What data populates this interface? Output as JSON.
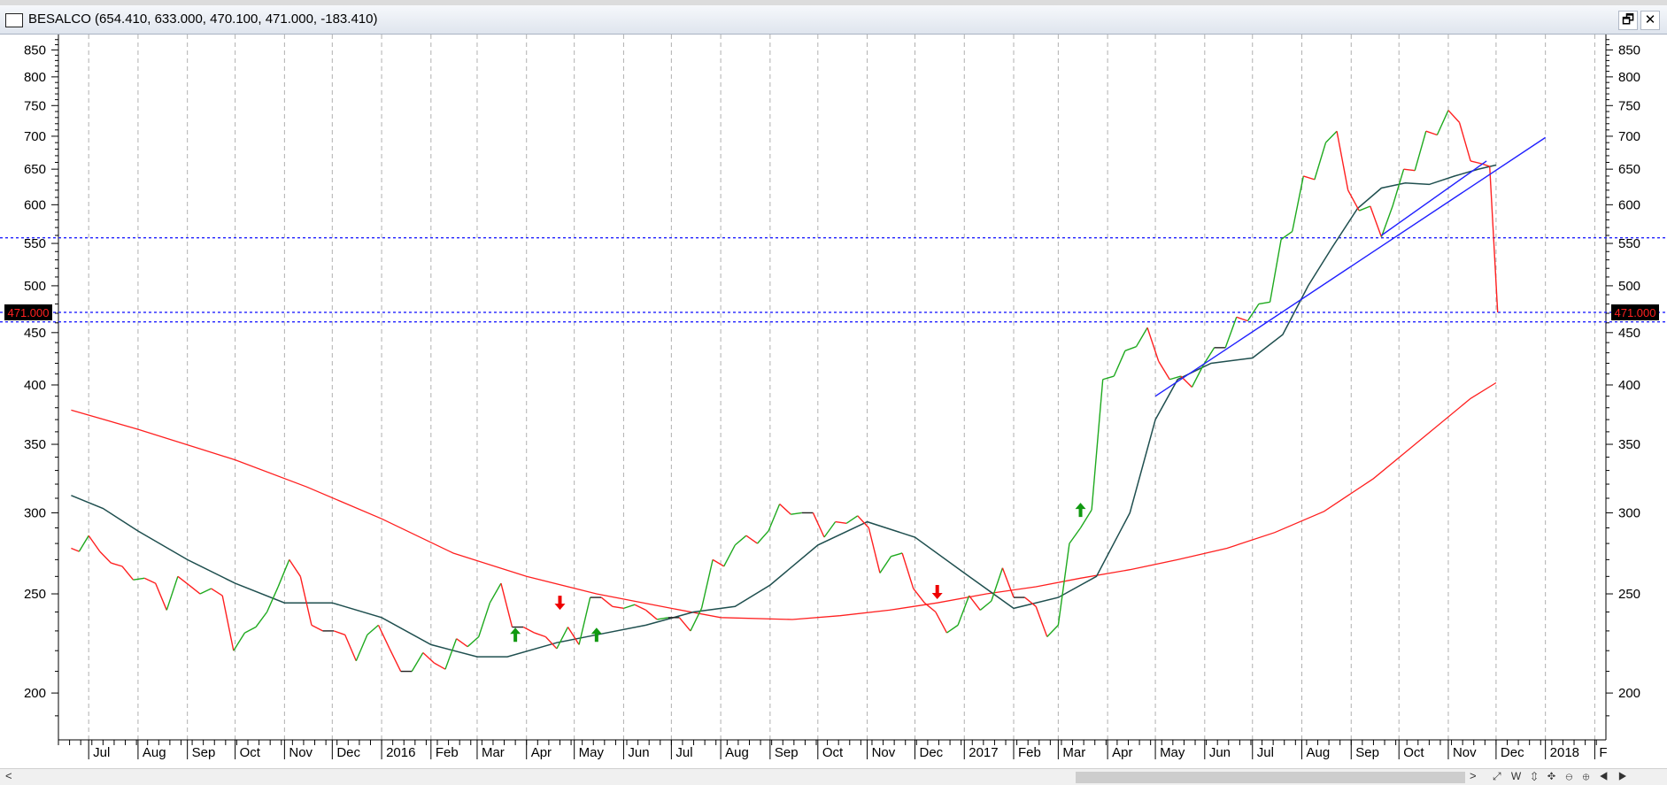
{
  "window": {
    "title": "BESALCO (654.410, 633.000, 470.100, 471.000, -183.410)",
    "restore_glyph": "🗗",
    "close_glyph": "✕"
  },
  "scrollbar": {
    "left_arrow": "<",
    "right_arrow": ">",
    "tool_glyphs": "⤢ W ⇕ ✥ ⊖ ⊕ ◀ ▶"
  },
  "chart_data": {
    "type": "line",
    "y_scale": "log",
    "ylim": [
      180,
      880
    ],
    "y_ticks": [
      200,
      250,
      300,
      350,
      400,
      450,
      500,
      550,
      600,
      650,
      700,
      750,
      800,
      850
    ],
    "last_price_label": "471.000",
    "last_price": 471,
    "x_labels": [
      {
        "label": "Jul",
        "date": "2015-07"
      },
      {
        "label": "Aug",
        "date": "2015-08"
      },
      {
        "label": "Sep",
        "date": "2015-09"
      },
      {
        "label": "Oct",
        "date": "2015-10"
      },
      {
        "label": "Nov",
        "date": "2015-11"
      },
      {
        "label": "Dec",
        "date": "2015-12"
      },
      {
        "label": "2016",
        "date": "2016-01"
      },
      {
        "label": "Feb",
        "date": "2016-02"
      },
      {
        "label": "Mar",
        "date": "2016-03"
      },
      {
        "label": "Apr",
        "date": "2016-04"
      },
      {
        "label": "May",
        "date": "2016-05"
      },
      {
        "label": "Jun",
        "date": "2016-06"
      },
      {
        "label": "Jul",
        "date": "2016-07"
      },
      {
        "label": "Aug",
        "date": "2016-08"
      },
      {
        "label": "Sep",
        "date": "2016-09"
      },
      {
        "label": "Oct",
        "date": "2016-10"
      },
      {
        "label": "Nov",
        "date": "2016-11"
      },
      {
        "label": "Dec",
        "date": "2016-12"
      },
      {
        "label": "2017",
        "date": "2017-01"
      },
      {
        "label": "Feb",
        "date": "2017-02"
      },
      {
        "label": "Mar",
        "date": "2017-03"
      },
      {
        "label": "Apr",
        "date": "2017-04"
      },
      {
        "label": "May",
        "date": "2017-05"
      },
      {
        "label": "Jun",
        "date": "2017-06"
      },
      {
        "label": "Jul",
        "date": "2017-07"
      },
      {
        "label": "Aug",
        "date": "2017-08"
      },
      {
        "label": "Sep",
        "date": "2017-09"
      },
      {
        "label": "Oct",
        "date": "2017-10"
      },
      {
        "label": "Nov",
        "date": "2017-11"
      },
      {
        "label": "Dec",
        "date": "2017-12"
      },
      {
        "label": "2018",
        "date": "2018-01"
      },
      {
        "label": "F",
        "date": "2018-02"
      }
    ],
    "horizontal_lines": [
      {
        "value": 557,
        "color": "#2020ff",
        "style": "dotted"
      },
      {
        "value": 471,
        "color": "#2020ff",
        "style": "dotted"
      },
      {
        "value": 461,
        "color": "#2020ff",
        "style": "dotted"
      }
    ],
    "trendlines": [
      {
        "color": "#2020ff",
        "points": [
          [
            "2017-05-01",
            390
          ],
          [
            "2018-01-01",
            698
          ]
        ]
      },
      {
        "color": "#2020ff",
        "points": [
          [
            "2017-09-20",
            560
          ],
          [
            "2017-11-25",
            662
          ]
        ]
      }
    ],
    "signals": [
      {
        "date": "2016-03-25",
        "value": 228,
        "kind": "buy"
      },
      {
        "date": "2016-04-22",
        "value": 245,
        "kind": "sell"
      },
      {
        "date": "2016-05-15",
        "value": 228,
        "kind": "buy"
      },
      {
        "date": "2016-12-15",
        "value": 251,
        "kind": "sell"
      },
      {
        "date": "2017-03-15",
        "value": 302,
        "kind": "buy"
      }
    ],
    "series": [
      {
        "kind": "price",
        "color_up": "#1faa1f",
        "color_down": "#ff2020",
        "color_neutral": "#222222",
        "points": [
          [
            "2015-06-20",
            277
          ],
          [
            "2015-06-25",
            275
          ],
          [
            "2015-07-01",
            285
          ],
          [
            "2015-07-08",
            275
          ],
          [
            "2015-07-15",
            268
          ],
          [
            "2015-07-22",
            266
          ],
          [
            "2015-07-29",
            258
          ],
          [
            "2015-08-05",
            259
          ],
          [
            "2015-08-12",
            256
          ],
          [
            "2015-08-19",
            241
          ],
          [
            "2015-08-26",
            260
          ],
          [
            "2015-09-02",
            255
          ],
          [
            "2015-09-09",
            250
          ],
          [
            "2015-09-16",
            253
          ],
          [
            "2015-09-23",
            249
          ],
          [
            "2015-09-30",
            220
          ],
          [
            "2015-10-07",
            229
          ],
          [
            "2015-10-14",
            232
          ],
          [
            "2015-10-21",
            240
          ],
          [
            "2015-10-28",
            254
          ],
          [
            "2015-11-04",
            270
          ],
          [
            "2015-11-11",
            260
          ],
          [
            "2015-11-18",
            233
          ],
          [
            "2015-11-25",
            230
          ],
          [
            "2015-12-02",
            230
          ],
          [
            "2015-12-09",
            228
          ],
          [
            "2015-12-16",
            215
          ],
          [
            "2015-12-23",
            228
          ],
          [
            "2015-12-30",
            233
          ],
          [
            "2016-01-06",
            221
          ],
          [
            "2016-01-13",
            210
          ],
          [
            "2016-01-20",
            210
          ],
          [
            "2016-01-27",
            219
          ],
          [
            "2016-02-03",
            214
          ],
          [
            "2016-02-10",
            211
          ],
          [
            "2016-02-17",
            226
          ],
          [
            "2016-02-24",
            222
          ],
          [
            "2016-03-02",
            227
          ],
          [
            "2016-03-09",
            245
          ],
          [
            "2016-03-16",
            256
          ],
          [
            "2016-03-23",
            232
          ],
          [
            "2016-03-30",
            232
          ],
          [
            "2016-04-06",
            229
          ],
          [
            "2016-04-13",
            227
          ],
          [
            "2016-04-20",
            221
          ],
          [
            "2016-04-27",
            232
          ],
          [
            "2016-05-04",
            223
          ],
          [
            "2016-05-11",
            248
          ],
          [
            "2016-05-18",
            248
          ],
          [
            "2016-05-25",
            243
          ],
          [
            "2016-06-01",
            242
          ],
          [
            "2016-06-08",
            244
          ],
          [
            "2016-06-15",
            241
          ],
          [
            "2016-06-22",
            236
          ],
          [
            "2016-06-29",
            237
          ],
          [
            "2016-07-06",
            237
          ],
          [
            "2016-07-13",
            230
          ],
          [
            "2016-07-20",
            242
          ],
          [
            "2016-07-27",
            270
          ],
          [
            "2016-08-03",
            266
          ],
          [
            "2016-08-10",
            279
          ],
          [
            "2016-08-17",
            285
          ],
          [
            "2016-08-24",
            280
          ],
          [
            "2016-08-31",
            288
          ],
          [
            "2016-09-07",
            306
          ],
          [
            "2016-09-14",
            299
          ],
          [
            "2016-09-21",
            300
          ],
          [
            "2016-09-28",
            300
          ],
          [
            "2016-10-05",
            284
          ],
          [
            "2016-10-12",
            294
          ],
          [
            "2016-10-19",
            293
          ],
          [
            "2016-10-26",
            298
          ],
          [
            "2016-11-02",
            290
          ],
          [
            "2016-11-09",
            262
          ],
          [
            "2016-11-16",
            272
          ],
          [
            "2016-11-23",
            274
          ],
          [
            "2016-11-30",
            253
          ],
          [
            "2016-12-07",
            245
          ],
          [
            "2016-12-14",
            240
          ],
          [
            "2016-12-21",
            229
          ],
          [
            "2016-12-28",
            233
          ],
          [
            "2017-01-04",
            249
          ],
          [
            "2017-01-11",
            241
          ],
          [
            "2017-01-18",
            246
          ],
          [
            "2017-01-25",
            265
          ],
          [
            "2017-02-01",
            248
          ],
          [
            "2017-02-08",
            248
          ],
          [
            "2017-02-15",
            243
          ],
          [
            "2017-02-22",
            227
          ],
          [
            "2017-03-01",
            233
          ],
          [
            "2017-03-08",
            280
          ],
          [
            "2017-03-15",
            290
          ],
          [
            "2017-03-22",
            302
          ],
          [
            "2017-03-29",
            405
          ],
          [
            "2017-04-05",
            408
          ],
          [
            "2017-04-12",
            432
          ],
          [
            "2017-04-19",
            436
          ],
          [
            "2017-04-26",
            455
          ],
          [
            "2017-05-03",
            422
          ],
          [
            "2017-05-10",
            405
          ],
          [
            "2017-05-17",
            408
          ],
          [
            "2017-05-24",
            398
          ],
          [
            "2017-05-31",
            418
          ],
          [
            "2017-06-07",
            435
          ],
          [
            "2017-06-14",
            435
          ],
          [
            "2017-06-21",
            466
          ],
          [
            "2017-06-28",
            462
          ],
          [
            "2017-07-05",
            480
          ],
          [
            "2017-07-12",
            482
          ],
          [
            "2017-07-19",
            555
          ],
          [
            "2017-07-26",
            565
          ],
          [
            "2017-08-02",
            640
          ],
          [
            "2017-08-09",
            635
          ],
          [
            "2017-08-16",
            690
          ],
          [
            "2017-08-23",
            708
          ],
          [
            "2017-08-30",
            620
          ],
          [
            "2017-09-06",
            592
          ],
          [
            "2017-09-13",
            598
          ],
          [
            "2017-09-20",
            558
          ],
          [
            "2017-09-27",
            598
          ],
          [
            "2017-10-04",
            650
          ],
          [
            "2017-10-11",
            648
          ],
          [
            "2017-10-18",
            708
          ],
          [
            "2017-10-25",
            702
          ],
          [
            "2017-11-01",
            742
          ],
          [
            "2017-11-08",
            722
          ],
          [
            "2017-11-15",
            662
          ],
          [
            "2017-11-22",
            658
          ],
          [
            "2017-11-27",
            654
          ],
          [
            "2017-12-02",
            471
          ]
        ]
      },
      {
        "kind": "sma-short",
        "color": "#1f4f4f",
        "points": [
          [
            "2015-06-20",
            312
          ],
          [
            "2015-07-10",
            303
          ],
          [
            "2015-08-01",
            288
          ],
          [
            "2015-09-01",
            270
          ],
          [
            "2015-10-01",
            256
          ],
          [
            "2015-11-01",
            245
          ],
          [
            "2015-12-01",
            245
          ],
          [
            "2016-01-01",
            237
          ],
          [
            "2016-02-01",
            223
          ],
          [
            "2016-03-01",
            217
          ],
          [
            "2016-03-20",
            217
          ],
          [
            "2016-04-20",
            224
          ],
          [
            "2016-05-15",
            228
          ],
          [
            "2016-06-15",
            233
          ],
          [
            "2016-07-15",
            240
          ],
          [
            "2016-08-10",
            243
          ],
          [
            "2016-09-01",
            255
          ],
          [
            "2016-10-01",
            279
          ],
          [
            "2016-11-01",
            294
          ],
          [
            "2016-12-01",
            284
          ],
          [
            "2017-01-01",
            262
          ],
          [
            "2017-02-01",
            242
          ],
          [
            "2017-03-01",
            248
          ],
          [
            "2017-03-25",
            260
          ],
          [
            "2017-04-15",
            300
          ],
          [
            "2017-05-01",
            370
          ],
          [
            "2017-05-15",
            405
          ],
          [
            "2017-06-05",
            420
          ],
          [
            "2017-07-01",
            425
          ],
          [
            "2017-07-20",
            448
          ],
          [
            "2017-08-05",
            500
          ],
          [
            "2017-08-20",
            545
          ],
          [
            "2017-09-05",
            595
          ],
          [
            "2017-09-20",
            623
          ],
          [
            "2017-10-05",
            630
          ],
          [
            "2017-10-20",
            628
          ],
          [
            "2017-11-05",
            640
          ],
          [
            "2017-11-20",
            650
          ],
          [
            "2017-12-01",
            656
          ]
        ]
      },
      {
        "kind": "sma-long",
        "color": "#ff2020",
        "points": [
          [
            "2015-06-20",
            378
          ],
          [
            "2015-08-01",
            362
          ],
          [
            "2015-10-01",
            338
          ],
          [
            "2015-11-15",
            318
          ],
          [
            "2016-01-01",
            296
          ],
          [
            "2016-02-15",
            274
          ],
          [
            "2016-04-01",
            260
          ],
          [
            "2016-05-15",
            250
          ],
          [
            "2016-07-01",
            242
          ],
          [
            "2016-08-01",
            237
          ],
          [
            "2016-09-15",
            236
          ],
          [
            "2016-10-15",
            238
          ],
          [
            "2016-11-15",
            241
          ],
          [
            "2016-12-15",
            245
          ],
          [
            "2017-01-15",
            250
          ],
          [
            "2017-02-15",
            254
          ],
          [
            "2017-03-15",
            259
          ],
          [
            "2017-04-15",
            264
          ],
          [
            "2017-05-15",
            270
          ],
          [
            "2017-06-15",
            277
          ],
          [
            "2017-07-15",
            287
          ],
          [
            "2017-08-15",
            301
          ],
          [
            "2017-09-15",
            324
          ],
          [
            "2017-10-15",
            354
          ],
          [
            "2017-11-15",
            388
          ],
          [
            "2017-12-01",
            402
          ]
        ]
      }
    ]
  }
}
